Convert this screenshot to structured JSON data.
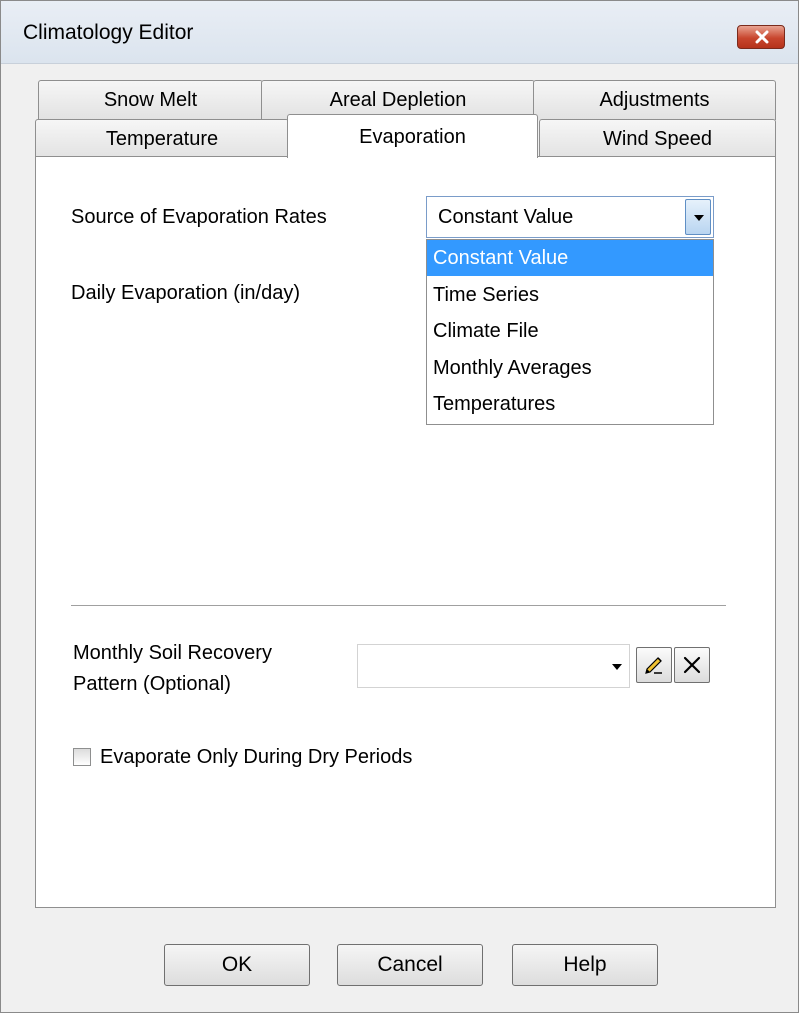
{
  "window": {
    "title": "Climatology Editor"
  },
  "tabs": {
    "row_back": [
      {
        "label": "Snow Melt"
      },
      {
        "label": "Areal Depletion"
      },
      {
        "label": "Adjustments"
      }
    ],
    "row_front": [
      {
        "label": "Temperature"
      },
      {
        "label": "Evaporation",
        "active": true
      },
      {
        "label": "Wind Speed"
      }
    ]
  },
  "evaporation": {
    "source_label": "Source of Evaporation  Rates",
    "source_selected": "Constant Value",
    "source_options": [
      "Constant Value",
      "Time Series",
      "Climate File",
      "Monthly Averages",
      "Temperatures"
    ],
    "daily_label": "Daily Evaporation (in/day)",
    "soil_recovery_label_line1": "Monthly Soil Recovery",
    "soil_recovery_label_line2": "Pattern (Optional)",
    "soil_recovery_value": "",
    "dry_periods_label": "Evaporate Only During Dry Periods",
    "dry_periods_checked": false
  },
  "buttons": {
    "ok": "OK",
    "cancel": "Cancel",
    "help": "Help"
  },
  "icons": {
    "close": "close-icon",
    "dropdown": "chevron-down-icon",
    "edit": "pencil-edit-icon",
    "delete": "delete-x-icon"
  },
  "colors": {
    "selection": "#3399ff",
    "close_button": "#c8462e"
  }
}
